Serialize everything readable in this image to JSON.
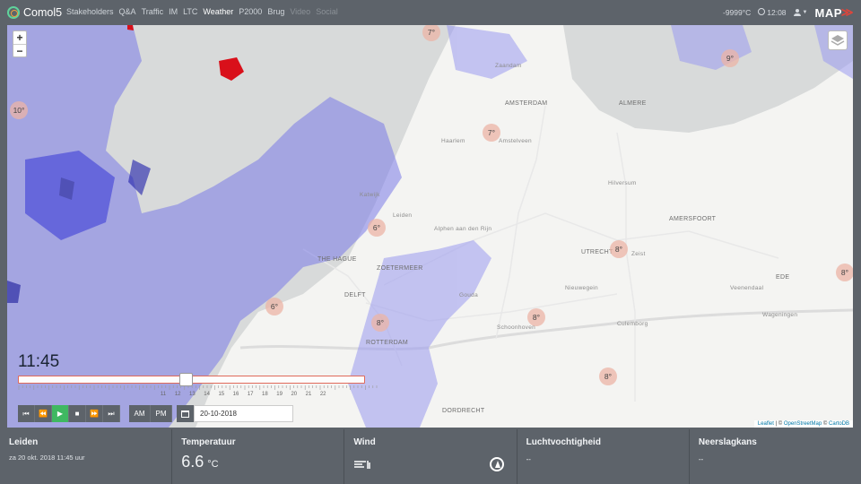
{
  "app": {
    "name": "Comol5"
  },
  "nav": {
    "items": [
      {
        "label": "Stakeholders",
        "state": "normal"
      },
      {
        "label": "Q&A",
        "state": "normal"
      },
      {
        "label": "Traffic",
        "state": "normal"
      },
      {
        "label": "IM",
        "state": "normal"
      },
      {
        "label": "LTC",
        "state": "normal"
      },
      {
        "label": "Weather",
        "state": "active"
      },
      {
        "label": "P2000",
        "state": "normal"
      },
      {
        "label": "Brug",
        "state": "normal"
      },
      {
        "label": "Video",
        "state": "disabled"
      },
      {
        "label": "Social",
        "state": "disabled"
      }
    ]
  },
  "header_right": {
    "temperature": "-9999°C",
    "time": "12:08",
    "logo_text": "MAP",
    "logo_chevron": "≫",
    "user_icon": "user-icon"
  },
  "map": {
    "zoom_in": "+",
    "zoom_out": "−",
    "layers_icon": "layers-icon",
    "attribution": {
      "leaflet": "Leaflet",
      "sep": " | © ",
      "osm": "OpenStreetMap",
      "mid": " © ",
      "carto": "CartoDB"
    },
    "temp_markers": [
      "7°",
      "9°",
      "10°",
      "7°",
      "6°",
      "8°",
      "8°",
      "6°",
      "8°",
      "8°",
      "8°"
    ],
    "cities": [
      "AMSTERDAM",
      "THE HAGUE",
      "ROTTERDAM",
      "UTRECHT",
      "AMERSFOORT",
      "ZOETERMEER",
      "DORDRECHT",
      "DELFT",
      "ALMERE",
      "Haarlem",
      "Leiden",
      "Hilversum",
      "Gouda",
      "Zaandam",
      "Amstelveen",
      "Schoonhoven",
      "Nieuwegein",
      "Zeist",
      "Culemborg",
      "Wageningen",
      "EDE",
      "Veenendaal",
      "Katwijk",
      "Alphen aan den Rijn"
    ]
  },
  "timeline": {
    "current_time": "11:45",
    "position": 0.48,
    "tick_labels": [
      "11",
      "12",
      "13",
      "14",
      "15",
      "16",
      "17",
      "18",
      "19",
      "20",
      "21",
      "22"
    ]
  },
  "player": {
    "buttons": [
      {
        "name": "first-frame",
        "glyph": "⏮"
      },
      {
        "name": "step-back",
        "glyph": "⏪"
      },
      {
        "name": "play",
        "glyph": "▶"
      },
      {
        "name": "stop",
        "glyph": "■"
      },
      {
        "name": "step-forward",
        "glyph": "⏩"
      },
      {
        "name": "last-frame",
        "glyph": "⏭"
      }
    ],
    "am": "AM",
    "pm": "PM",
    "date": "20-10-2018"
  },
  "panel": {
    "location": {
      "title": "Leiden",
      "subtitle": "za 20 okt. 2018 11:45 uur"
    },
    "temperature": {
      "title": "Temperatuur",
      "value": "6.6",
      "unit": "°C"
    },
    "wind": {
      "title": "Wind"
    },
    "humidity": {
      "title": "Luchtvochtigheid",
      "value": "--"
    },
    "precip": {
      "title": "Neerslagkans",
      "value": "--"
    }
  },
  "colors": {
    "header_bg": "#5d636a",
    "play_green": "#3fb861",
    "accent_red": "#e0453b",
    "rain_blue": "#4b4be0"
  }
}
